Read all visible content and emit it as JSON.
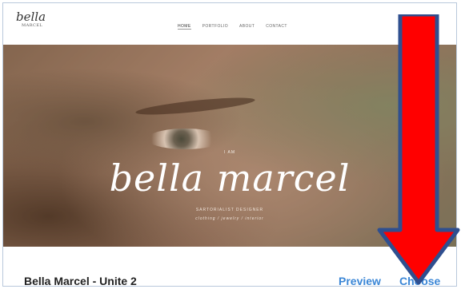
{
  "site": {
    "logo_script": "bella",
    "logo_small": "MARCEL",
    "nav": [
      "HOME",
      "PORTFOLIO",
      "ABOUT",
      "CONTACT"
    ]
  },
  "hero": {
    "intro": "I AM",
    "name": "bella marcel",
    "role": "SARTORIALIST DESIGNER",
    "tags": "clothing / jewelry / interior"
  },
  "template": {
    "title": "Bella Marcel - Unite 2",
    "preview_label": "Preview",
    "choose_label": "Choose"
  },
  "annotation": {
    "arrow_color": "#ff0000",
    "arrow_outline": "#2f4f8f",
    "icon": "down-arrow-icon"
  }
}
